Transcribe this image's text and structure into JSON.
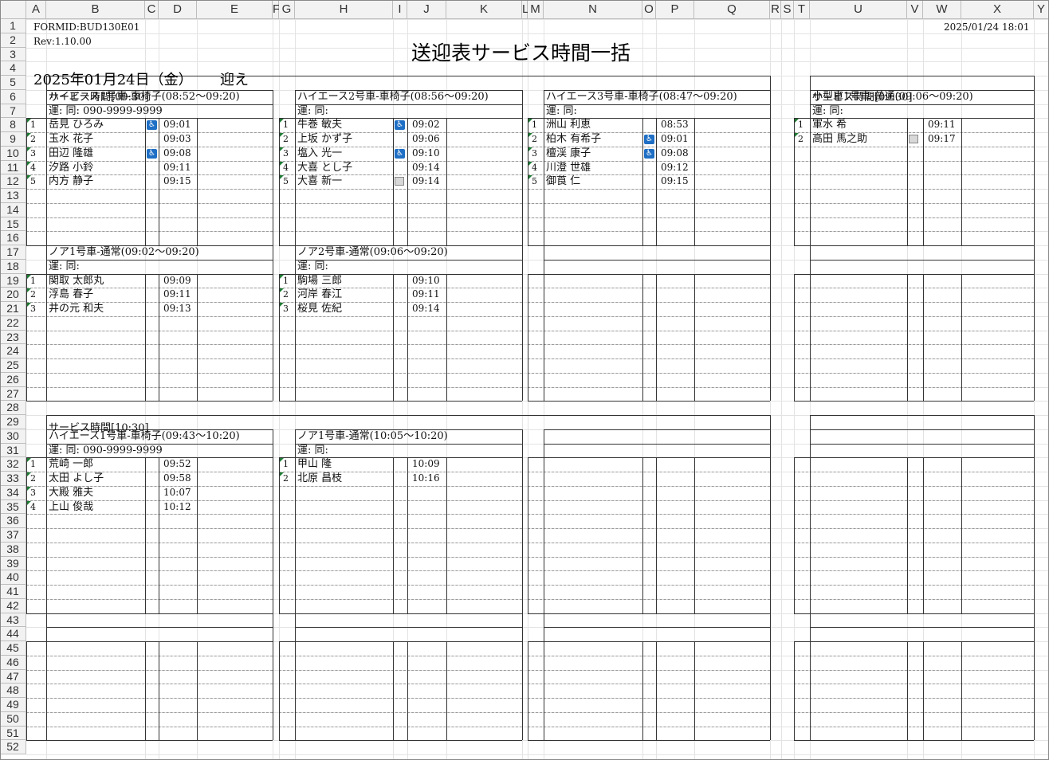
{
  "header": {
    "form_id": "FORMID:BUD130E01",
    "rev": "Rev:1.10.00",
    "timestamp": "2025/01/24 18:01",
    "title": "送迎表サービス時間一括",
    "date": "2025年01月24日（金）",
    "mode": "迎え"
  },
  "columns": [
    "A",
    "B",
    "C",
    "D",
    "E",
    "F",
    "G",
    "H",
    "I",
    "J",
    "K",
    "L",
    "M",
    "N",
    "O",
    "P",
    "Q",
    "R",
    "S",
    "T",
    "U",
    "V",
    "W",
    "X",
    "Y"
  ],
  "rows": [
    "1",
    "2",
    "3",
    "4",
    "5",
    "6",
    "7",
    "8",
    "9",
    "10",
    "11",
    "12",
    "13",
    "14",
    "15",
    "16",
    "17",
    "18",
    "19",
    "20",
    "21",
    "22",
    "23",
    "24",
    "25",
    "26",
    "27",
    "28",
    "29",
    "30",
    "31",
    "32",
    "33",
    "34",
    "35",
    "36",
    "37",
    "38",
    "39",
    "40",
    "41",
    "42",
    "43",
    "44",
    "45",
    "46",
    "47",
    "48",
    "49",
    "50",
    "51",
    "52"
  ],
  "service_labels": {
    "s1_left": "サービス時間[09:30]",
    "s1_right": "サービス時間[09:30]",
    "s2_left": "サービス時間[10:30]"
  },
  "vehicles": [
    {
      "title": "ハイエース1号車-車椅子(08:52〜09:20)",
      "driver": "運: 同: 090-9999-9999",
      "passengers": [
        {
          "no": "1",
          "name": "岳見 ひろみ",
          "time": "09:01",
          "icon": "wheelchair-icon"
        },
        {
          "no": "2",
          "name": "玉水 花子",
          "time": "09:03",
          "icon": ""
        },
        {
          "no": "3",
          "name": "田辺 隆雄",
          "time": "09:08",
          "icon": "wheelchair-icon"
        },
        {
          "no": "4",
          "name": "汐路 小鈴",
          "time": "09:11",
          "icon": ""
        },
        {
          "no": "5",
          "name": "内方 静子",
          "time": "09:15",
          "icon": ""
        }
      ]
    },
    {
      "title": "ハイエース2号車-車椅子(08:56〜09:20)",
      "driver": "運: 同:",
      "passengers": [
        {
          "no": "1",
          "name": "牛巻 敏夫",
          "time": "09:02",
          "icon": "wheelchair-icon"
        },
        {
          "no": "2",
          "name": "上坂 かず子",
          "time": "09:06",
          "icon": ""
        },
        {
          "no": "3",
          "name": "塩入 光一",
          "time": "09:10",
          "icon": "wheelchair-icon"
        },
        {
          "no": "4",
          "name": "大喜 とし子",
          "time": "09:14",
          "icon": ""
        },
        {
          "no": "5",
          "name": "大喜 新一",
          "time": "09:14",
          "icon": "note-icon"
        }
      ]
    },
    {
      "title": "ハイエース3号車-車椅子(08:47〜09:20)",
      "driver": "運: 同:",
      "passengers": [
        {
          "no": "1",
          "name": "洲山 利恵",
          "time": "08:53",
          "icon": ""
        },
        {
          "no": "2",
          "name": "柏木 有希子",
          "time": "09:01",
          "icon": "wheelchair-icon"
        },
        {
          "no": "3",
          "name": "檀渓 康子",
          "time": "09:08",
          "icon": "wheelchair-icon"
        },
        {
          "no": "4",
          "name": "川澄 世雄",
          "time": "09:12",
          "icon": ""
        },
        {
          "no": "5",
          "name": "御莨 仁",
          "time": "09:15",
          "icon": ""
        }
      ]
    },
    {
      "title": "小型車1号車-普通(09:06〜09:20)",
      "driver": "運: 同:",
      "passengers": [
        {
          "no": "1",
          "name": "軍水 希",
          "time": "09:11",
          "icon": ""
        },
        {
          "no": "2",
          "name": "高田 馬之助",
          "time": "09:17",
          "icon": "note-icon"
        }
      ]
    },
    {
      "title": "ノア1号車-通常(09:02〜09:20)",
      "driver": "運: 同:",
      "passengers": [
        {
          "no": "1",
          "name": "関取 太郎丸",
          "time": "09:09",
          "icon": ""
        },
        {
          "no": "2",
          "name": "浮島 春子",
          "time": "09:11",
          "icon": ""
        },
        {
          "no": "3",
          "name": "井の元 和夫",
          "time": "09:13",
          "icon": ""
        }
      ]
    },
    {
      "title": "ノア2号車-通常(09:06〜09:20)",
      "driver": "運: 同:",
      "passengers": [
        {
          "no": "1",
          "name": "駒場 三郎",
          "time": "09:10",
          "icon": ""
        },
        {
          "no": "2",
          "name": "河岸 春江",
          "time": "09:11",
          "icon": ""
        },
        {
          "no": "3",
          "name": "桜見 佐紀",
          "time": "09:14",
          "icon": ""
        }
      ]
    },
    {
      "title": "ハイエース1号車-車椅子(09:43〜10:20)",
      "driver": "運: 同: 090-9999-9999",
      "passengers": [
        {
          "no": "1",
          "name": "荒崎 一郎",
          "time": "09:52",
          "icon": ""
        },
        {
          "no": "2",
          "name": "太田 よし子",
          "time": "09:58",
          "icon": ""
        },
        {
          "no": "3",
          "name": "大殿 雅夫",
          "time": "10:07",
          "icon": ""
        },
        {
          "no": "4",
          "name": "上山 俊哉",
          "time": "10:12",
          "icon": ""
        }
      ]
    },
    {
      "title": "ノア1号車-通常(10:05〜10:20)",
      "driver": "運: 同:",
      "passengers": [
        {
          "no": "1",
          "name": "甲山 隆",
          "time": "10:09",
          "icon": ""
        },
        {
          "no": "2",
          "name": "北原 昌枝",
          "time": "10:16",
          "icon": ""
        }
      ]
    }
  ]
}
